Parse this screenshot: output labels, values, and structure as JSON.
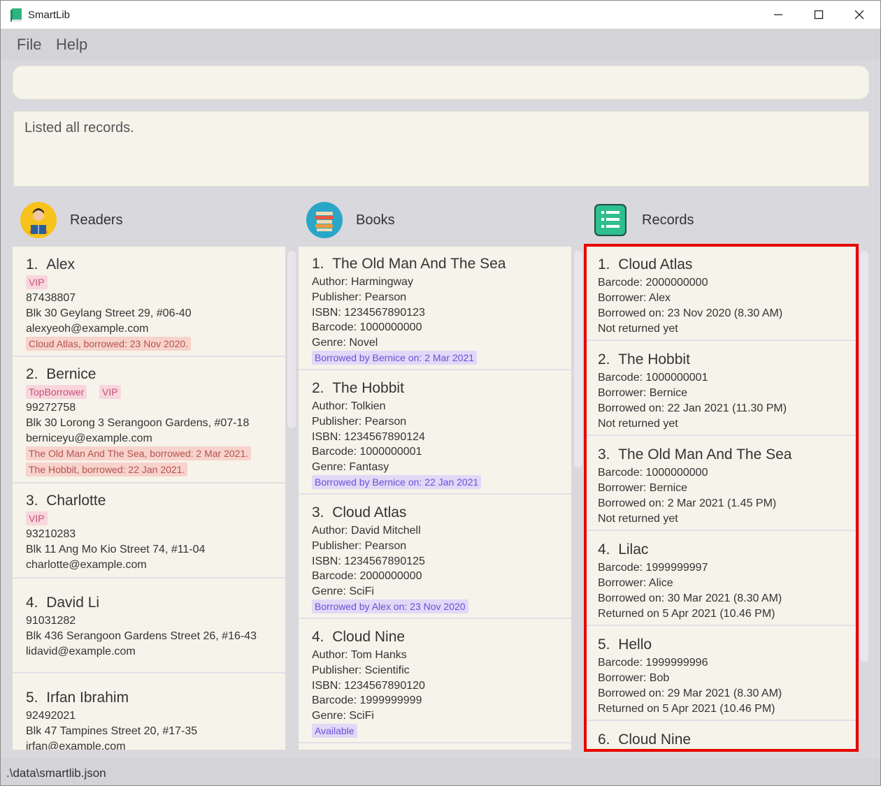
{
  "app": {
    "title": "SmartLib"
  },
  "menu": {
    "file": "File",
    "help": "Help"
  },
  "command": {
    "value": ""
  },
  "result": {
    "text": "Listed all records."
  },
  "panels": {
    "readers": "Readers",
    "books": "Books",
    "records": "Records"
  },
  "readers": [
    {
      "index": "1.",
      "name": "Alex",
      "tags": [
        "VIP"
      ],
      "phone": "87438807",
      "address": "Blk 30 Geylang Street 29, #06-40",
      "email": "alexyeoh@example.com",
      "borrowed": [
        "Cloud Atlas, borrowed: 23 Nov 2020."
      ]
    },
    {
      "index": "2.",
      "name": "Bernice",
      "tags": [
        "TopBorrower",
        "VIP"
      ],
      "phone": "99272758",
      "address": "Blk 30 Lorong 3 Serangoon Gardens, #07-18",
      "email": "berniceyu@example.com",
      "borrowed": [
        "The Old Man And The Sea, borrowed: 2 Mar 2021.",
        "The Hobbit, borrowed: 22 Jan 2021."
      ]
    },
    {
      "index": "3.",
      "name": "Charlotte",
      "tags": [
        "VIP"
      ],
      "phone": "93210283",
      "address": "Blk 11 Ang Mo Kio Street 74, #11-04",
      "email": "charlotte@example.com",
      "borrowed": []
    },
    {
      "index": "4.",
      "name": "David Li",
      "tags": [],
      "phone": "91031282",
      "address": "Blk 436 Serangoon Gardens Street 26, #16-43",
      "email": "lidavid@example.com",
      "borrowed": []
    },
    {
      "index": "5.",
      "name": "Irfan Ibrahim",
      "tags": [],
      "phone": "92492021",
      "address": "Blk 47 Tampines Street 20, #17-35",
      "email": "irfan@example.com",
      "borrowed": []
    }
  ],
  "books": [
    {
      "index": "1.",
      "title": "The Old Man And The Sea",
      "author": "Author: Harmingway",
      "publisher": "Publisher: Pearson",
      "isbn": "ISBN: 1234567890123",
      "barcode": "Barcode: 1000000000",
      "genre": "Genre: Novel",
      "status": "Borrowed by Bernice on: 2 Mar 2021"
    },
    {
      "index": "2.",
      "title": "The Hobbit",
      "author": "Author: Tolkien",
      "publisher": "Publisher: Pearson",
      "isbn": "ISBN: 1234567890124",
      "barcode": "Barcode: 1000000001",
      "genre": "Genre: Fantasy",
      "status": "Borrowed by Bernice on: 22 Jan 2021"
    },
    {
      "index": "3.",
      "title": "Cloud Atlas",
      "author": "Author: David Mitchell",
      "publisher": "Publisher: Pearson",
      "isbn": "ISBN: 1234567890125",
      "barcode": "Barcode: 2000000000",
      "genre": "Genre: SciFi",
      "status": "Borrowed by Alex on: 23 Nov 2020"
    },
    {
      "index": "4.",
      "title": "Cloud Nine",
      "author": "Author: Tom Hanks",
      "publisher": "Publisher: Scientific",
      "isbn": "ISBN: 1234567890120",
      "barcode": "Barcode: 1999999999",
      "genre": "Genre: SciFi",
      "status": "Available"
    }
  ],
  "records": [
    {
      "index": "1.",
      "title": "Cloud Atlas",
      "barcode": "Barcode: 2000000000",
      "borrower": "Borrower: Alex",
      "borrowed_on": "Borrowed on: 23 Nov 2020 (8.30 AM)",
      "returned": "Not returned yet"
    },
    {
      "index": "2.",
      "title": "The Hobbit",
      "barcode": "Barcode: 1000000001",
      "borrower": "Borrower: Bernice",
      "borrowed_on": "Borrowed on: 22 Jan 2021 (11.30 PM)",
      "returned": "Not returned yet"
    },
    {
      "index": "3.",
      "title": "The Old Man And The Sea",
      "barcode": "Barcode: 1000000000",
      "borrower": "Borrower: Bernice",
      "borrowed_on": "Borrowed on: 2 Mar 2021 (1.45 PM)",
      "returned": "Not returned yet"
    },
    {
      "index": "4.",
      "title": "Lilac",
      "barcode": "Barcode: 1999999997",
      "borrower": "Borrower: Alice",
      "borrowed_on": "Borrowed on: 30 Mar 2021 (8.30 AM)",
      "returned": "Returned on 5 Apr 2021 (10.46 PM)"
    },
    {
      "index": "5.",
      "title": "Hello",
      "barcode": "Barcode: 1999999996",
      "borrower": "Borrower: Bob",
      "borrowed_on": "Borrowed on: 29 Mar 2021 (8.30 AM)",
      "returned": "Returned on 5 Apr 2021 (10.46 PM)"
    },
    {
      "index": "6.",
      "title": "Cloud Nine",
      "barcode": "",
      "borrower": "",
      "borrowed_on": "",
      "returned": ""
    }
  ],
  "status": {
    "path": ".\\data\\smartlib.json"
  },
  "icons": {
    "app": "book-icon",
    "readers": "reader-avatar-icon",
    "books": "book-stack-icon",
    "records": "list-icon",
    "minimize": "minimize-icon",
    "maximize": "maximize-icon",
    "close": "close-icon"
  },
  "colors": {
    "card_bg": "#f6f3ea",
    "highlight": "#e60000",
    "vip_tag": "#f8d6dc",
    "borrowed_tag": "#f7d3cc",
    "book_status_tag": "#e0d9f7"
  }
}
